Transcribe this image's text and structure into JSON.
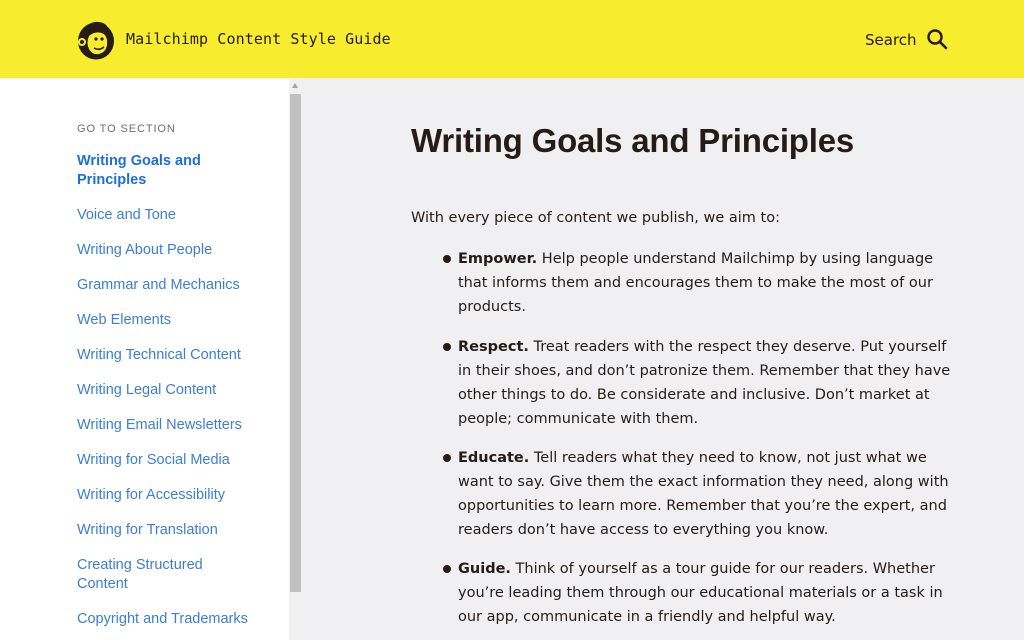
{
  "header": {
    "site_title": "Mailchimp Content Style Guide",
    "search_label": "Search",
    "background_color": "#f8ec2f",
    "logo_icon": "freddie-logo-icon",
    "search_icon": "search-icon"
  },
  "sidebar": {
    "section_label": "GO TO SECTION",
    "link_color": "#3b7fd4",
    "items": [
      {
        "label": "Writing Goals and Principles",
        "active": true
      },
      {
        "label": "Voice and Tone"
      },
      {
        "label": "Writing About People"
      },
      {
        "label": "Grammar and Mechanics"
      },
      {
        "label": "Web Elements"
      },
      {
        "label": "Writing Technical Content"
      },
      {
        "label": "Writing Legal Content"
      },
      {
        "label": "Writing Email Newsletters"
      },
      {
        "label": "Writing for Social Media"
      },
      {
        "label": "Writing for Accessibility"
      },
      {
        "label": "Writing for Translation"
      },
      {
        "label": "Creating Structured Content"
      },
      {
        "label": "Copyright and Trademarks"
      }
    ]
  },
  "main": {
    "title": "Writing Goals and Principles",
    "intro": "With every piece of content we publish, we aim to:",
    "principles": [
      {
        "term": "Empower.",
        "text": " Help people understand Mailchimp by using language that informs them and encourages them to make the most of our products."
      },
      {
        "term": "Respect.",
        "text": " Treat readers with the respect they deserve. Put yourself in their shoes, and don’t patronize them. Remember that they have other things to do. Be considerate and inclusive. Don’t market at people; communicate with them."
      },
      {
        "term": "Educate.",
        "text": " Tell readers what they need to know, not just what we want to say. Give them the exact information they need, along with opportunities to learn more. Remember that you’re the expert, and readers don’t have access to everything you know."
      },
      {
        "term": "Guide.",
        "text": " Think of yourself as a tour guide for our readers. Whether you’re leading them through our educational materials or a task in our app, communicate in a friendly and helpful way."
      }
    ]
  }
}
